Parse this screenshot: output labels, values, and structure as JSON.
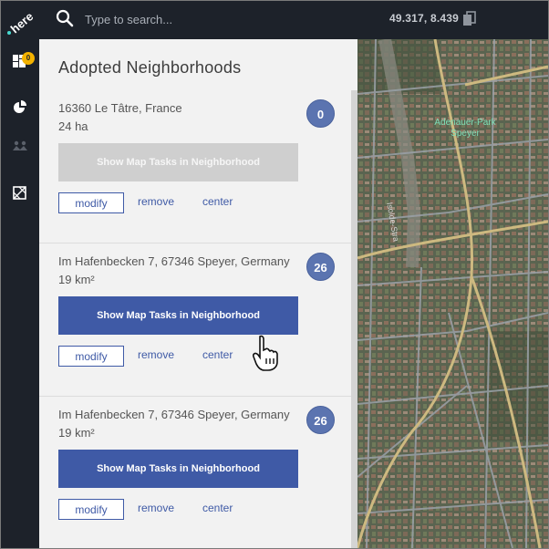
{
  "topbar": {
    "search_placeholder": "Type to search...",
    "coords": "49.317, 8.439"
  },
  "rail": {
    "badge": "0"
  },
  "panel": {
    "title": "Adopted Neighborhoods",
    "cards": [
      {
        "address": "16360 Le Tâtre, France",
        "size": "24 ha",
        "count": "0",
        "tasks_label": "Show Map Tasks in Neighborhood",
        "modify_label": "modify",
        "remove_label": "remove",
        "center_label": "center",
        "tasks_enabled": false
      },
      {
        "address": "Im Hafenbecken 7, 67346 Speyer, Germany",
        "size": "19 km²",
        "count": "26",
        "tasks_label": "Show Map Tasks in Neighborhood",
        "modify_label": "modify",
        "remove_label": "remove",
        "center_label": "center",
        "tasks_enabled": true
      },
      {
        "address": "Im Hafenbecken 7, 67346 Speyer, Germany",
        "size": "19 km²",
        "count": "26",
        "tasks_label": "Show Map Tasks in Neighborhood",
        "modify_label": "modify",
        "remove_label": "remove",
        "center_label": "center",
        "tasks_enabled": true
      }
    ]
  },
  "map": {
    "park_label": "Adenauer-Park Speyer",
    "street_label": "Isolde-Stra"
  },
  "colors": {
    "accent": "#3f5aa6",
    "badge": "#5b74b0",
    "rail_badge": "#f3b200",
    "bar": "#1d222a"
  }
}
